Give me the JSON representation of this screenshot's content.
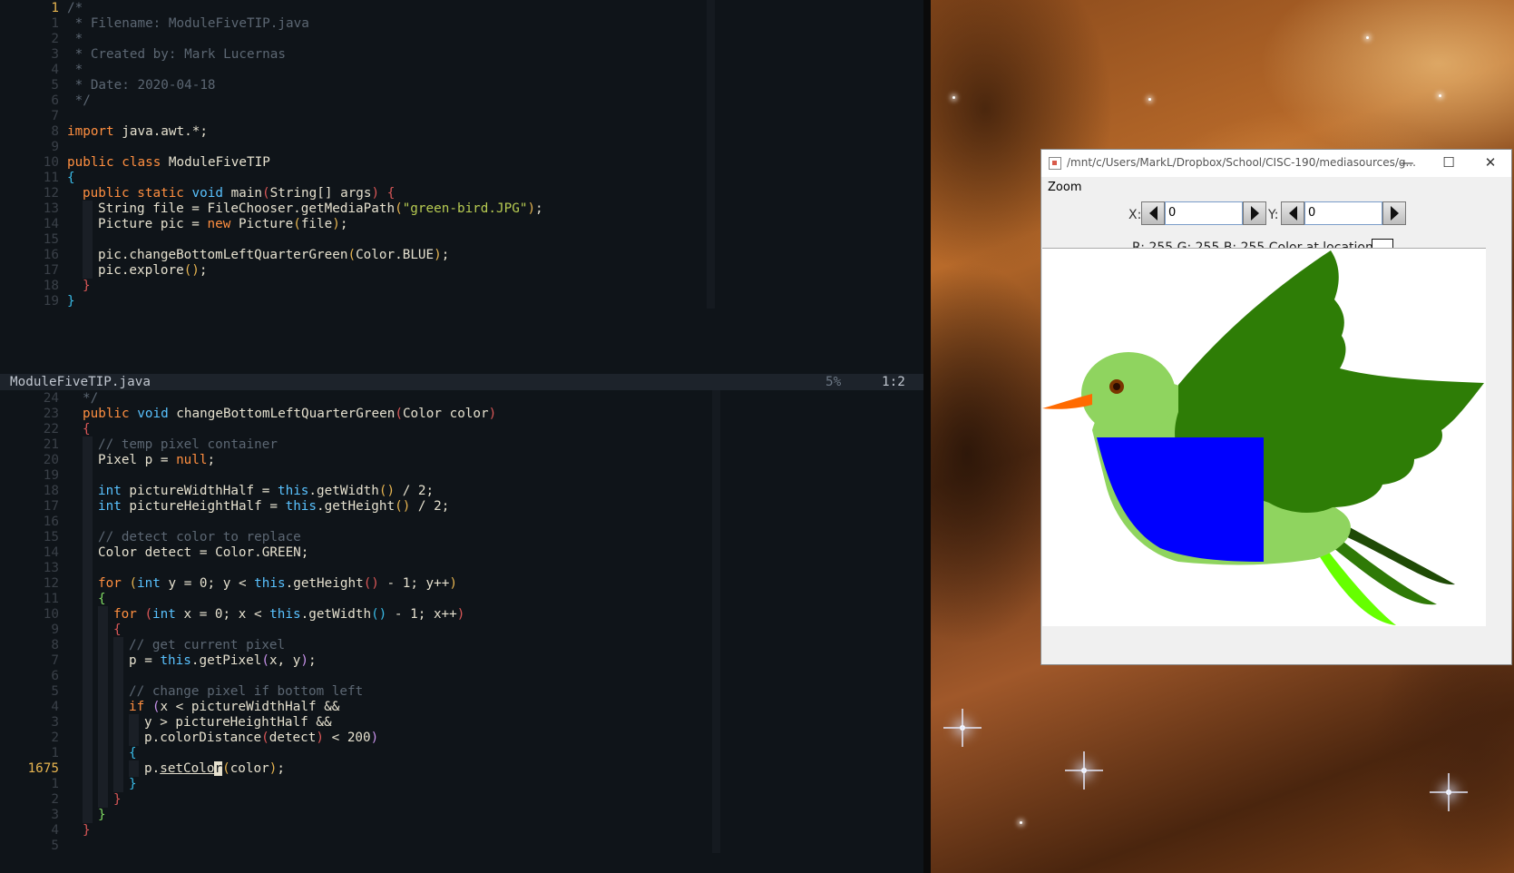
{
  "editor": {
    "top_pane": [
      {
        "ln": "1",
        "current": true,
        "ind": 0,
        "tokens": [
          [
            "c",
            "/*"
          ]
        ]
      },
      {
        "ln": "1",
        "ind": 0,
        "tokens": [
          [
            "c",
            " * Filename: ModuleFiveTIP.java"
          ]
        ]
      },
      {
        "ln": "2",
        "ind": 0,
        "tokens": [
          [
            "c",
            " *"
          ]
        ]
      },
      {
        "ln": "3",
        "ind": 0,
        "tokens": [
          [
            "c",
            " * Created by: Mark Lucernas"
          ]
        ]
      },
      {
        "ln": "4",
        "ind": 0,
        "tokens": [
          [
            "c",
            " *"
          ]
        ]
      },
      {
        "ln": "5",
        "ind": 0,
        "tokens": [
          [
            "c",
            " * Date: 2020-04-18"
          ]
        ]
      },
      {
        "ln": "6",
        "ind": 0,
        "tokens": [
          [
            "c",
            " */"
          ]
        ]
      },
      {
        "ln": "7",
        "ind": 0,
        "tokens": []
      },
      {
        "ln": "8",
        "ind": 0,
        "tokens": [
          [
            "k",
            "import"
          ],
          [
            "n",
            " java.awt.*;"
          ]
        ]
      },
      {
        "ln": "9",
        "ind": 0,
        "tokens": []
      },
      {
        "ln": "10",
        "ind": 0,
        "tokens": [
          [
            "k",
            "public"
          ],
          [
            "n",
            " "
          ],
          [
            "k",
            "class"
          ],
          [
            "n",
            " ModuleFiveTIP"
          ]
        ]
      },
      {
        "ln": "11",
        "ind": 0,
        "tokens": [
          [
            "b3",
            "{"
          ]
        ]
      },
      {
        "ln": "12",
        "ind": 1,
        "tokens": [
          [
            "k",
            "public"
          ],
          [
            "n",
            " "
          ],
          [
            "k",
            "static"
          ],
          [
            "n",
            " "
          ],
          [
            "t",
            "void"
          ],
          [
            "n",
            " main"
          ],
          [
            "b1",
            "("
          ],
          [
            "n",
            "String[] args"
          ],
          [
            "b1",
            ")"
          ],
          [
            "n",
            " "
          ],
          [
            "b1",
            "{"
          ]
        ]
      },
      {
        "ln": "13",
        "ind": 2,
        "tokens": [
          [
            "n",
            "String file = FileChooser.getMediaPath"
          ],
          [
            "b2",
            "("
          ],
          [
            "s",
            "\"green-bird.JPG\""
          ],
          [
            "b2",
            ")"
          ],
          [
            "n",
            ";"
          ]
        ]
      },
      {
        "ln": "14",
        "ind": 2,
        "tokens": [
          [
            "n",
            "Picture pic = "
          ],
          [
            "k",
            "new"
          ],
          [
            "n",
            " Picture"
          ],
          [
            "b2",
            "("
          ],
          [
            "n",
            "file"
          ],
          [
            "b2",
            ")"
          ],
          [
            "n",
            ";"
          ]
        ]
      },
      {
        "ln": "15",
        "ind": 2,
        "tokens": []
      },
      {
        "ln": "16",
        "ind": 2,
        "tokens": [
          [
            "n",
            "pic.changeBottomLeftQuarterGreen"
          ],
          [
            "b2",
            "("
          ],
          [
            "n",
            "Color.BLUE"
          ],
          [
            "b2",
            ")"
          ],
          [
            "n",
            ";"
          ]
        ]
      },
      {
        "ln": "17",
        "ind": 2,
        "tokens": [
          [
            "n",
            "pic.explore"
          ],
          [
            "b2",
            "()"
          ],
          [
            "n",
            ";"
          ]
        ]
      },
      {
        "ln": "18",
        "ind": 1,
        "tokens": [
          [
            "b1",
            "}"
          ]
        ]
      },
      {
        "ln": "19",
        "ind": 0,
        "tokens": [
          [
            "b3",
            "}"
          ]
        ]
      }
    ],
    "status": {
      "file": "ModuleFiveTIP.java",
      "percent": "5%",
      "position": "1:2"
    },
    "bottom_pane": [
      {
        "ln": "24",
        "ind": 1,
        "tokens": [
          [
            "c",
            "*/"
          ]
        ]
      },
      {
        "ln": "23",
        "ind": 1,
        "tokens": [
          [
            "k",
            "public"
          ],
          [
            "n",
            " "
          ],
          [
            "t",
            "void"
          ],
          [
            "n",
            " changeBottomLeftQuarterGreen"
          ],
          [
            "b1",
            "("
          ],
          [
            "n",
            "Color color"
          ],
          [
            "b1",
            ")"
          ]
        ]
      },
      {
        "ln": "22",
        "ind": 1,
        "tokens": [
          [
            "b1",
            "{"
          ]
        ]
      },
      {
        "ln": "21",
        "ind": 2,
        "tokens": [
          [
            "c",
            "// temp pixel container"
          ]
        ]
      },
      {
        "ln": "20",
        "ind": 2,
        "tokens": [
          [
            "n",
            "Pixel p = "
          ],
          [
            "k",
            "null"
          ],
          [
            "n",
            ";"
          ]
        ]
      },
      {
        "ln": "19",
        "ind": 2,
        "tokens": []
      },
      {
        "ln": "18",
        "ind": 2,
        "tokens": [
          [
            "t",
            "int"
          ],
          [
            "n",
            " pictureWidthHalf = "
          ],
          [
            "t",
            "this"
          ],
          [
            "n",
            ".getWidth"
          ],
          [
            "b2",
            "()"
          ],
          [
            "n",
            " / 2;"
          ]
        ]
      },
      {
        "ln": "17",
        "ind": 2,
        "tokens": [
          [
            "t",
            "int"
          ],
          [
            "n",
            " pictureHeightHalf = "
          ],
          [
            "t",
            "this"
          ],
          [
            "n",
            ".getHeight"
          ],
          [
            "b2",
            "()"
          ],
          [
            "n",
            " / 2;"
          ]
        ]
      },
      {
        "ln": "16",
        "ind": 2,
        "tokens": []
      },
      {
        "ln": "15",
        "ind": 2,
        "tokens": [
          [
            "c",
            "// detect color to replace"
          ]
        ]
      },
      {
        "ln": "14",
        "ind": 2,
        "tokens": [
          [
            "n",
            "Color detect = Color.GREEN;"
          ]
        ]
      },
      {
        "ln": "13",
        "ind": 2,
        "tokens": []
      },
      {
        "ln": "12",
        "ind": 2,
        "tokens": [
          [
            "k",
            "for"
          ],
          [
            "n",
            " "
          ],
          [
            "b2",
            "("
          ],
          [
            "t",
            "int"
          ],
          [
            "n",
            " y = 0; y < "
          ],
          [
            "t",
            "this"
          ],
          [
            "n",
            ".getHeight"
          ],
          [
            "b1",
            "()"
          ],
          [
            "n",
            " - 1; y++"
          ],
          [
            "b2",
            ")"
          ]
        ]
      },
      {
        "ln": "11",
        "ind": 2,
        "tokens": [
          [
            "b4",
            "{"
          ]
        ]
      },
      {
        "ln": "10",
        "ind": 3,
        "tokens": [
          [
            "k",
            "for"
          ],
          [
            "n",
            " "
          ],
          [
            "b1",
            "("
          ],
          [
            "t",
            "int"
          ],
          [
            "n",
            " x = 0; x < "
          ],
          [
            "t",
            "this"
          ],
          [
            "n",
            ".getWidth"
          ],
          [
            "b3",
            "()"
          ],
          [
            "n",
            " - 1; x++"
          ],
          [
            "b1",
            ")"
          ]
        ]
      },
      {
        "ln": "9",
        "ind": 3,
        "tokens": [
          [
            "b1",
            "{"
          ]
        ]
      },
      {
        "ln": "8",
        "ind": 4,
        "tokens": [
          [
            "c",
            "// get current pixel"
          ]
        ]
      },
      {
        "ln": "7",
        "ind": 4,
        "tokens": [
          [
            "n",
            "p = "
          ],
          [
            "t",
            "this"
          ],
          [
            "n",
            ".getPixel"
          ],
          [
            "b5",
            "("
          ],
          [
            "n",
            "x, y"
          ],
          [
            "b5",
            ")"
          ],
          [
            "n",
            ";"
          ]
        ]
      },
      {
        "ln": "6",
        "ind": 4,
        "tokens": []
      },
      {
        "ln": "5",
        "ind": 4,
        "tokens": [
          [
            "c",
            "// change pixel if bottom left"
          ]
        ]
      },
      {
        "ln": "4",
        "ind": 4,
        "tokens": [
          [
            "k",
            "if"
          ],
          [
            "n",
            " "
          ],
          [
            "b5",
            "("
          ],
          [
            "n",
            "x < pictureWidthHalf &&"
          ]
        ]
      },
      {
        "ln": "3",
        "ind": 5,
        "tokens": [
          [
            "n",
            "y > pictureHeightHalf &&"
          ]
        ]
      },
      {
        "ln": "2",
        "ind": 5,
        "tokens": [
          [
            "n",
            "p.colorDistance"
          ],
          [
            "b1",
            "("
          ],
          [
            "n",
            "detect"
          ],
          [
            "b1",
            ")"
          ],
          [
            "n",
            " < 200"
          ],
          [
            "b5",
            ")"
          ]
        ]
      },
      {
        "ln": "1",
        "ind": 4,
        "tokens": [
          [
            "b3",
            "{"
          ]
        ]
      },
      {
        "ln": "1675",
        "current": true,
        "ind": 5,
        "tokens": [
          [
            "n",
            "p."
          ],
          [
            "ul",
            "setColo"
          ],
          [
            "cursor",
            "r"
          ],
          [
            "b2",
            "("
          ],
          [
            "n",
            "color"
          ],
          [
            "b2",
            ")"
          ],
          [
            "n",
            ";"
          ]
        ]
      },
      {
        "ln": "1",
        "ind": 4,
        "tokens": [
          [
            "b3",
            "}"
          ]
        ]
      },
      {
        "ln": "2",
        "ind": 3,
        "tokens": [
          [
            "b1",
            "}"
          ]
        ]
      },
      {
        "ln": "3",
        "ind": 2,
        "tokens": [
          [
            "b4",
            "}"
          ]
        ]
      },
      {
        "ln": "4",
        "ind": 1,
        "tokens": [
          [
            "b1",
            "}"
          ]
        ]
      },
      {
        "ln": "5",
        "ind": 0,
        "tokens": []
      }
    ]
  },
  "viewer": {
    "title": "/mnt/c/Users/MarkL/Dropbox/School/CISC-190/mediasources/g...",
    "menu_zoom": "Zoom",
    "x_label": "X:",
    "y_label": "Y:",
    "x_value": "0",
    "y_value": "0",
    "color_text": "R: 255 G: 255 B: 255 Color at location:",
    "swatch_color": "#ffffff",
    "minimize": "—",
    "maximize": "☐",
    "close": "✕"
  },
  "colors": {
    "editor_bg": "#0f1419",
    "bird_light_green": "#8fd45f",
    "bird_dark_green": "#2e7d06",
    "bird_blue": "#0000ff",
    "beak_orange": "#ff6a00"
  }
}
